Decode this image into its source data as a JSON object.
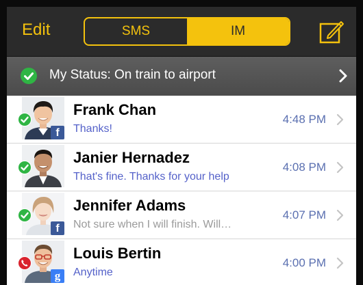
{
  "topbar": {
    "edit_label": "Edit",
    "segments": [
      {
        "label": "SMS",
        "selected": false
      },
      {
        "label": "IM",
        "selected": true
      }
    ],
    "compose_icon": "compose-icon"
  },
  "status": {
    "text": "My Status: On train to airport",
    "icon": "check-circle-icon"
  },
  "conversations": [
    {
      "name": "Frank Chan",
      "preview": "Thanks!",
      "time": "4:48 PM",
      "presence": "available",
      "network": "facebook",
      "preview_color": "blue"
    },
    {
      "name": "Janier Hernadez",
      "preview": "That's fine. Thanks for your help",
      "time": "4:08 PM",
      "presence": "available",
      "network": "",
      "preview_color": "blue"
    },
    {
      "name": "Jennifer Adams",
      "preview": "Not sure when I will finish. Will…",
      "time": "4:07 PM",
      "presence": "available",
      "network": "facebook",
      "preview_color": "gray"
    },
    {
      "name": "Louis Bertin",
      "preview": "Anytime",
      "time": "4:00 PM",
      "presence": "on-call",
      "network": "google",
      "preview_color": "blue"
    }
  ],
  "colors": {
    "accent": "#f4c20d",
    "available": "#2fb544",
    "on_call": "#d9232e",
    "facebook": "#3b5998",
    "google": "#3a7ff6"
  }
}
